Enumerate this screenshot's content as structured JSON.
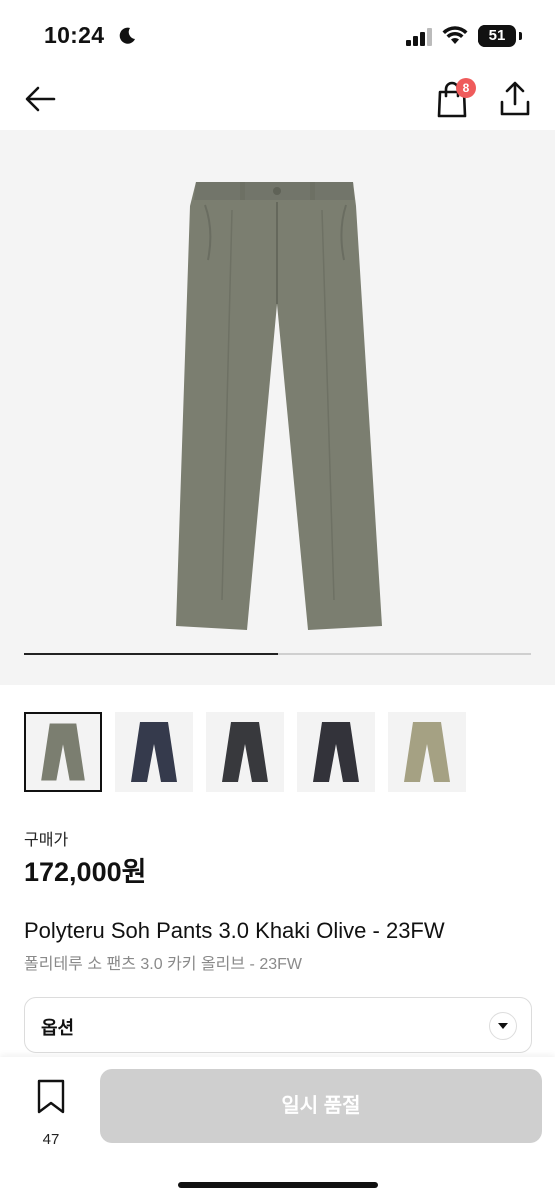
{
  "status_bar": {
    "time": "10:24",
    "battery": "51",
    "battery_percent": 51,
    "icons": [
      "moon-icon",
      "signal-icon",
      "wifi-icon",
      "battery-icon"
    ]
  },
  "nav": {
    "back_icon": "arrow-left-icon",
    "cart_icon": "shopping-bag-icon",
    "cart_badge": "8",
    "share_icon": "share-upload-icon"
  },
  "gallery": {
    "progress_fraction": 0.5,
    "thumbnails": [
      {
        "color_name": "khaki-olive",
        "color": "#7b7e70",
        "selected": true
      },
      {
        "color_name": "navy",
        "color": "#353a4c",
        "selected": false
      },
      {
        "color_name": "charcoal",
        "color": "#38393d",
        "selected": false
      },
      {
        "color_name": "black-navy",
        "color": "#33333a",
        "selected": false
      },
      {
        "color_name": "beige-khaki",
        "color": "#a5a183",
        "selected": false
      }
    ]
  },
  "colors": {
    "product_main": "#7b7e70",
    "badge": "#ef5b5b",
    "disabled_button": "#cfcfcf"
  },
  "price": {
    "label": "구매가",
    "value": "172,000원"
  },
  "product": {
    "title_en": "Polyteru Soh Pants 3.0 Khaki Olive - 23FW",
    "title_ko": "폴리테루 소 팬츠 3.0 카키 올리브 - 23FW"
  },
  "options": {
    "label": "옵션",
    "chevron_icon": "chevron-down-icon"
  },
  "bottom": {
    "bookmark_icon": "bookmark-icon",
    "bookmark_count": "47",
    "button_label": "일시 품절"
  }
}
